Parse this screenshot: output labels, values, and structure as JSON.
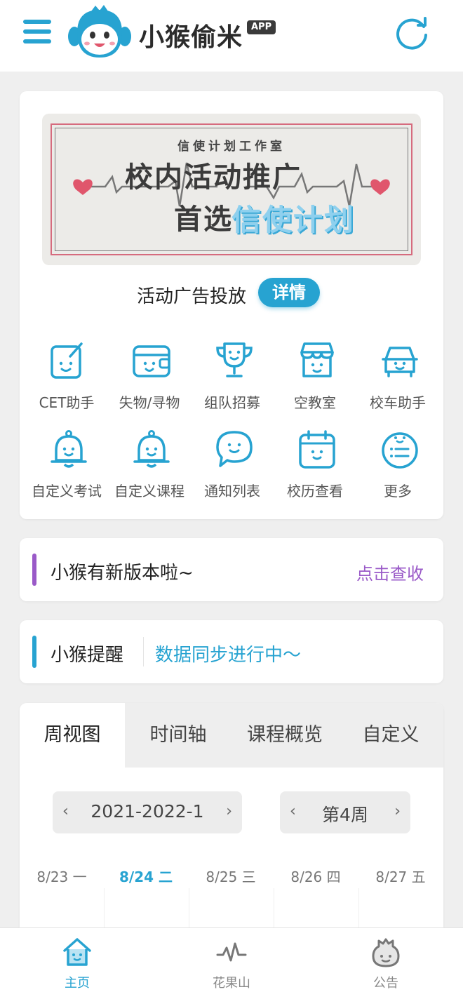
{
  "header": {
    "title": "小猴偷米",
    "badge": "APP",
    "menu_icon": "menu-icon",
    "refresh_icon": "refresh-icon",
    "accent": "#27a3d1"
  },
  "banner": {
    "subtitle": "信使计划工作室",
    "line1": "校内活动推广",
    "line2_prefix": "首选",
    "line2_highlight": "信使计划"
  },
  "ad": {
    "label": "活动广告投放",
    "button": "详情"
  },
  "features": [
    {
      "label": "CET助手",
      "icon": "cet-notebook-icon"
    },
    {
      "label": "失物/寻物",
      "icon": "wallet-icon"
    },
    {
      "label": "组队招募",
      "icon": "trophy-icon"
    },
    {
      "label": "空教室",
      "icon": "classroom-icon"
    },
    {
      "label": "校车助手",
      "icon": "bus-icon"
    },
    {
      "label": "自定义考试",
      "icon": "bell-icon"
    },
    {
      "label": "自定义课程",
      "icon": "bell-icon"
    },
    {
      "label": "通知列表",
      "icon": "chat-bubble-icon"
    },
    {
      "label": "校历查看",
      "icon": "calendar-icon"
    },
    {
      "label": "更多",
      "icon": "more-list-icon"
    }
  ],
  "update_notice": {
    "title": "小猴有新版本啦~",
    "link": "点击查收",
    "bar_color": "#9a5ac8"
  },
  "reminder": {
    "title": "小猴提醒",
    "status": "数据同步进行中～",
    "bar_color": "#27a3d1"
  },
  "schedule": {
    "tabs": [
      "周视图",
      "时间轴",
      "课程概览",
      "自定义"
    ],
    "active_tab": 0,
    "term": "2021-2022-1",
    "week": "第4周",
    "prev": "‹",
    "next": "›",
    "days": [
      "8/23 一",
      "8/24 二",
      "8/25 三",
      "8/26 四",
      "8/27 五"
    ],
    "today_index": 1
  },
  "bottom_nav": [
    {
      "label": "主页",
      "icon": "home-icon",
      "active": true
    },
    {
      "label": "花果山",
      "icon": "pulse-icon",
      "active": false
    },
    {
      "label": "公告",
      "icon": "monkey-icon",
      "active": false
    }
  ]
}
